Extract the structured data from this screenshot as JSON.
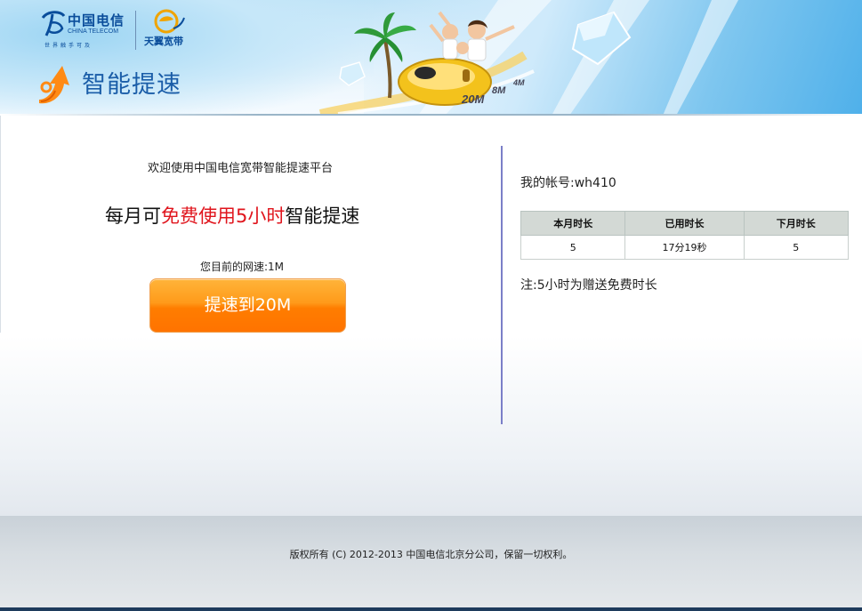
{
  "header": {
    "telecom_name": "中国电信",
    "telecom_en": "CHINA TELECOM",
    "telecom_slogan": "世界触手可及",
    "tianyi_name": "天翼宽带",
    "page_title": "智能提速",
    "speed_tags": [
      "20M",
      "8M",
      "4M"
    ]
  },
  "main": {
    "welcome": "欢迎使用中国电信宽带智能提速平台",
    "headline_prefix": "每月可",
    "headline_highlight": "免费使用5小时",
    "headline_suffix": "智能提速",
    "current_speed_label": "您目前的网速:",
    "current_speed_value": "1M",
    "boost_button": "提速到20M"
  },
  "account": {
    "label": "我的帐号:",
    "value": "wh410"
  },
  "usage_table": {
    "headers": [
      "本月时长",
      "已用时长",
      "下月时长"
    ],
    "row": [
      "5",
      "17分19秒",
      "5"
    ]
  },
  "note": "注:5小时为赠送免费时长",
  "footer": {
    "copyright": "版权所有 (C) 2012-2013 中国电信北京分公司，保留一切权利。"
  },
  "colors": {
    "accent_blue": "#1a5da8",
    "highlight_red": "#e0151d",
    "button_orange": "#ff8a0d",
    "divider": "#7b7fc8"
  }
}
